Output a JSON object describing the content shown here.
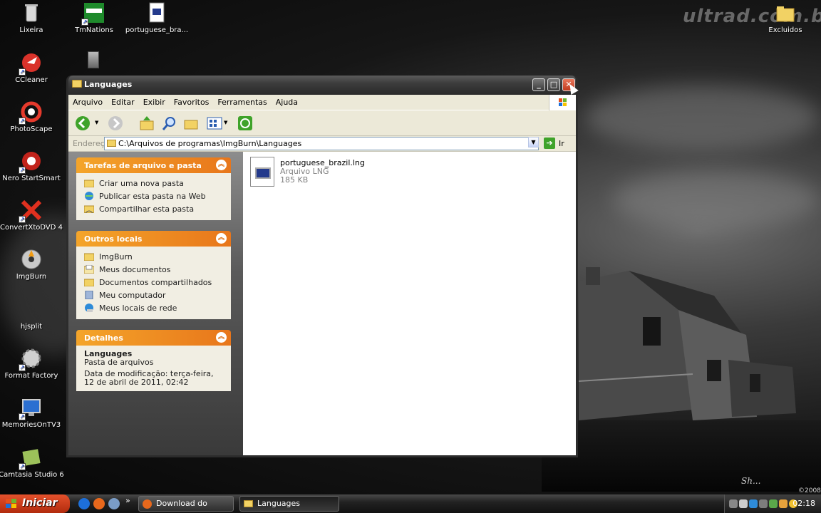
{
  "desktop": {
    "watermark": "ultrad.com.br",
    "signature": "Sh...",
    "year": "©2008",
    "icons": [
      {
        "label": "Lixeira",
        "icon": "recycle-bin-icon"
      },
      {
        "label": "TmNations",
        "icon": "tmnations-icon"
      },
      {
        "label": "portuguese_bra...",
        "icon": "lng-file-icon"
      },
      {
        "label": "Excluidos",
        "icon": "folder-icon"
      },
      {
        "label": "CCleaner",
        "icon": "ccleaner-icon"
      },
      {
        "label": "PhotoScape",
        "icon": "photoscape-icon"
      },
      {
        "label": "Nero StartSmart",
        "icon": "nero-icon"
      },
      {
        "label": "ConvertXtoDVD 4",
        "icon": "convertxtodvd-icon"
      },
      {
        "label": "ImgBurn",
        "icon": "imgburn-icon"
      },
      {
        "label": "hjsplit",
        "icon": "hjsplit-icon"
      },
      {
        "label": "Format Factory",
        "icon": "format-factory-icon"
      },
      {
        "label": "MemoriesOnTV3",
        "icon": "memoriesontv-icon"
      },
      {
        "label": "Camtasia Studio 6",
        "icon": "camtasia-icon"
      }
    ]
  },
  "window": {
    "title": "Languages",
    "menu": [
      "Arquivo",
      "Editar",
      "Exibir",
      "Favoritos",
      "Ferramentas",
      "Ajuda"
    ],
    "address": {
      "label": "Endereço",
      "path": "C:\\Arquivos de programas\\ImgBurn\\Languages",
      "go_label": "Ir"
    },
    "tasks_panel": {
      "title": "Tarefas de arquivo e pasta",
      "items": [
        "Criar uma nova pasta",
        "Publicar esta pasta na Web",
        "Compartilhar esta pasta"
      ]
    },
    "places_panel": {
      "title": "Outros locais",
      "items": [
        "ImgBurn",
        "Meus documentos",
        "Documentos compartilhados",
        "Meu computador",
        "Meus locais de rede"
      ]
    },
    "details_panel": {
      "title": "Detalhes",
      "name": "Languages",
      "type": "Pasta de arquivos",
      "modified": "Data de modificação: terça-feira, 12 de abril de 2011, 02:42"
    },
    "file": {
      "name": "portuguese_brazil.lng",
      "type": "Arquivo LNG",
      "size": "185 KB"
    }
  },
  "taskbar": {
    "start_label": "Iniciar",
    "quicklaunch_more": "»",
    "tasks": [
      {
        "label": "Download do Traduçã..."
      },
      {
        "label": "Languages"
      }
    ],
    "clock": "02:18"
  }
}
